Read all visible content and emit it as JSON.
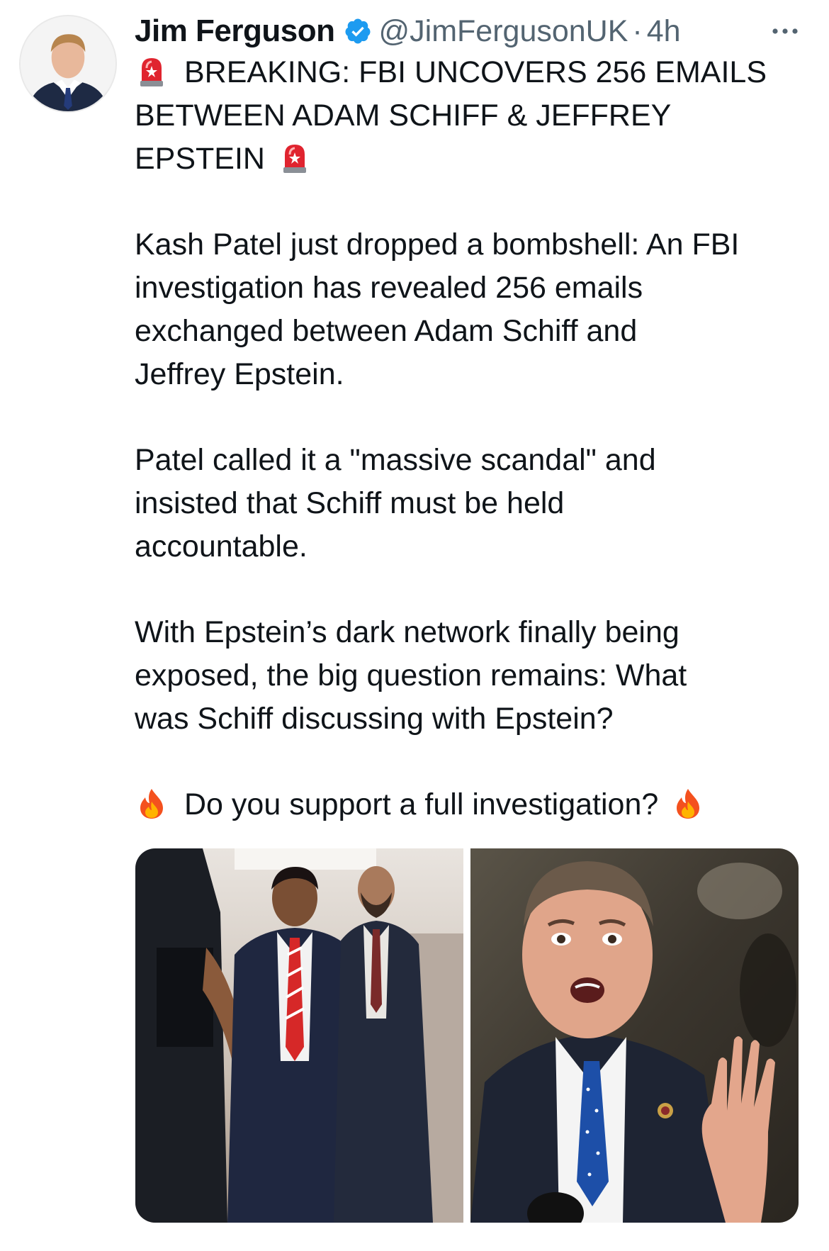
{
  "author": {
    "name": "Jim Ferguson",
    "handle": "@JimFergusonUK",
    "separator": "·",
    "time": "4h"
  },
  "tweet": {
    "headline_lines": [
      "BREAKING: FBI UNCOVERS 256 EMAILS",
      "BETWEEN ADAM SCHIFF & JEFFREY",
      "EPSTEIN"
    ],
    "paragraph1_lines": [
      "Kash Patel just dropped a bombshell: An FBI",
      "investigation has revealed 256 emails",
      "exchanged between Adam Schiff and",
      "Jeffrey Epstein."
    ],
    "paragraph2_lines": [
      "Patel called it a \"massive scandal\" and",
      "insisted that Schiff must be held",
      "accountable."
    ],
    "paragraph3_lines": [
      "With Epstein’s dark network finally being",
      "exposed, the big question remains: What",
      "was Schiff discussing with Epstein?"
    ],
    "question": "Do you support a full investigation?"
  },
  "icons": {
    "verified": "verified-badge-icon",
    "more": "more-options-icon",
    "siren": "police-siren-emoji",
    "fire": "fire-emoji"
  },
  "colors": {
    "text": "#0f1419",
    "secondary": "#536471",
    "verified": "#1d9bf0"
  }
}
